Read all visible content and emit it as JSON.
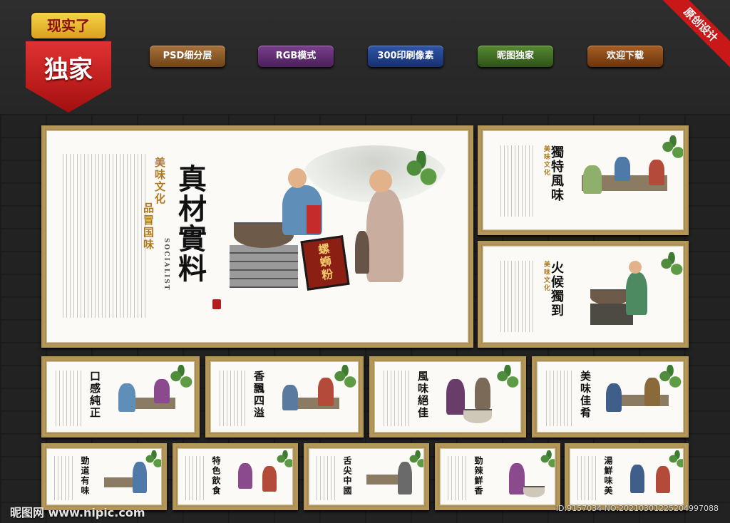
{
  "badge": {
    "top_text": "现实了",
    "main_text": "独家"
  },
  "pills": [
    {
      "label": "PSD细分层",
      "color": "#8a5a22"
    },
    {
      "label": "RGB模式",
      "color": "#5c2a6e"
    },
    {
      "label": "300印刷像素",
      "color": "#1f3f86"
    },
    {
      "label": "昵图独家",
      "color": "#3f6a22"
    },
    {
      "label": "欢迎下载",
      "color": "#8a4a14"
    }
  ],
  "corner_ribbon": "原创设计",
  "colors": {
    "frame": "#b49656",
    "accent_red": "#c81818"
  },
  "main_panel": {
    "title": "真材實料",
    "vertical_brand": "美味文化",
    "vertical_brand2": "品冒国味",
    "sign_text": "螺蛳粉",
    "socialist": "SOCIALIST"
  },
  "panels": [
    {
      "title": "獨特風味"
    },
    {
      "title": "火候獨到"
    },
    {
      "title": "口感純正"
    },
    {
      "title": "香飄四溢"
    },
    {
      "title": "風味絕佳"
    },
    {
      "title": "美味佳肴"
    },
    {
      "title": "勁道有味"
    },
    {
      "title": "特色飲食"
    },
    {
      "title": "舌尖中國"
    },
    {
      "title": "勁辣鮮香"
    },
    {
      "title": "湯鮮味美"
    }
  ],
  "watermark": {
    "left": "昵图网 www.nipic.com",
    "right": "ID:9157034 NO:20210301225204997088"
  }
}
